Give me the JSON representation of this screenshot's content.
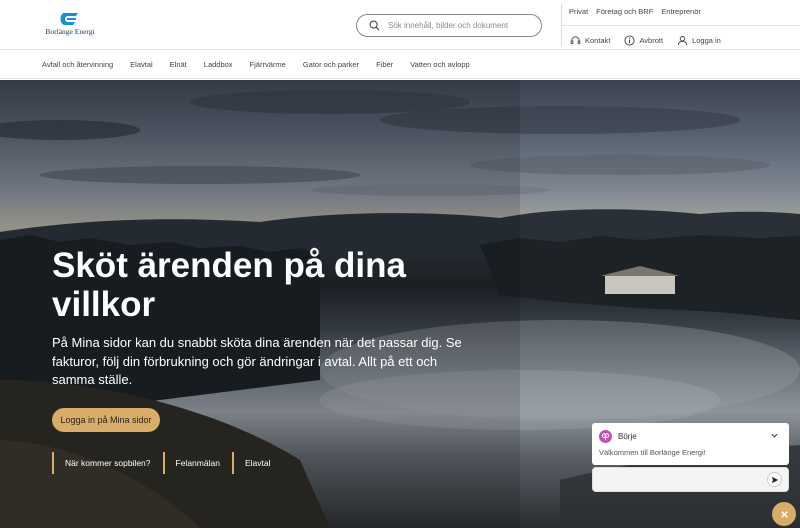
{
  "header": {
    "logo_text": "Borlänge Energi",
    "search_placeholder": "Sök innehåll, bilder och dokument",
    "segments": [
      "Privat",
      "Företag och BRF",
      "Entreprenör"
    ],
    "utilities": [
      {
        "label": "Kontakt",
        "icon": "headset-icon"
      },
      {
        "label": "Avbrott",
        "icon": "info-icon"
      },
      {
        "label": "Logga in",
        "icon": "user-icon"
      }
    ]
  },
  "nav": {
    "items": [
      "Avfall och återvinning",
      "Elavtal",
      "Elnät",
      "Laddbox",
      "Fjärrvärme",
      "Gator och parker",
      "Fiber",
      "Vatten och avlopp"
    ]
  },
  "hero": {
    "title": "Sköt ärenden på dina villkor",
    "description": "På Mina sidor kan du snabbt sköta dina ärenden när det passar dig. Se fakturor, följ din förbrukning och gör ändringar i avtal. Allt på ett och samma ställe.",
    "cta_label": "Logga in på Mina sidor",
    "quick_links": [
      "När kommer sopbilen?",
      "Felanmälan",
      "Elavtal"
    ]
  },
  "chat": {
    "bot_name": "Börje",
    "welcome": "Välkommen till Borlänge Energi!",
    "input_value": ""
  },
  "colors": {
    "accent": "#d8ad6a",
    "brand_blue": "#1a8fd6",
    "chat_avatar": "#c24fb8"
  }
}
